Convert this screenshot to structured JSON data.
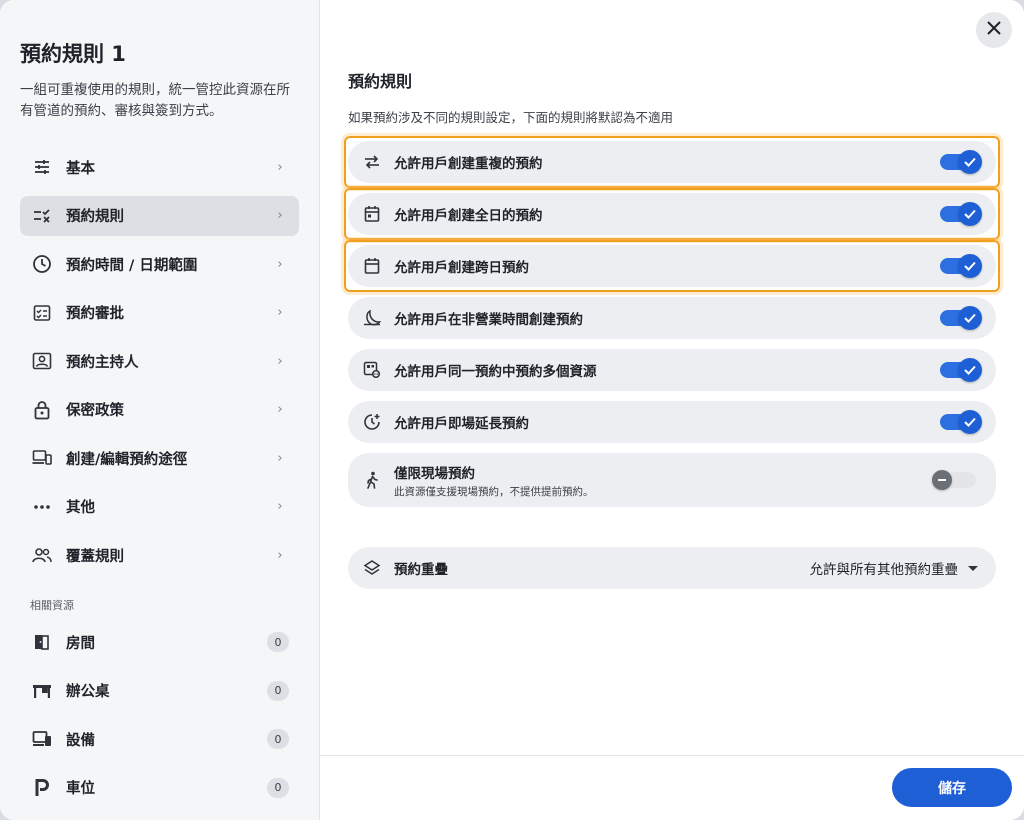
{
  "sidebar": {
    "title": "預約規則 1",
    "description": "一組可重複使用的規則，統一管控此資源在所有管道的預約、審核與簽到方式。",
    "items": [
      {
        "label": "基本",
        "icon": "sliders-icon"
      },
      {
        "label": "預約規則",
        "icon": "rule-list-icon",
        "active": true
      },
      {
        "label": "預約時間 / 日期範圍",
        "icon": "clock-icon"
      },
      {
        "label": "預約審批",
        "icon": "approval-checklist-icon"
      },
      {
        "label": "預約主持人",
        "icon": "host-badge-icon"
      },
      {
        "label": "保密政策",
        "icon": "lock-icon"
      },
      {
        "label": "創建/編輯預約途徑",
        "icon": "devices-icon"
      },
      {
        "label": "其他",
        "icon": "more-dots-icon"
      },
      {
        "label": "覆蓋規則",
        "icon": "people-icon"
      }
    ],
    "related_section_label": "相關資源",
    "resources": [
      {
        "label": "房間",
        "count": "0",
        "icon": "door-icon"
      },
      {
        "label": "辦公桌",
        "count": "0",
        "icon": "desk-icon"
      },
      {
        "label": "設備",
        "count": "0",
        "icon": "equipment-icon"
      },
      {
        "label": "車位",
        "count": "0",
        "icon": "parking-icon"
      }
    ]
  },
  "main": {
    "title": "預約規則",
    "subtitle": "如果預約涉及不同的規則設定，下面的規則將默認為不適用",
    "rows": [
      {
        "label": "允許用戶創建重複的預約",
        "enabled": true,
        "icon": "repeat-icon",
        "highlighted": true
      },
      {
        "label": "允許用戶創建全日的預約",
        "enabled": true,
        "icon": "calendar-day-icon",
        "highlighted": true
      },
      {
        "label": "允許用戶創建跨日預約",
        "enabled": true,
        "icon": "calendar-range-icon",
        "highlighted": true
      },
      {
        "label": "允許用戶在非營業時間創建預約",
        "enabled": true,
        "icon": "moon-icon"
      },
      {
        "label": "允許用戶同一預約中預約多個資源",
        "enabled": true,
        "icon": "multi-resource-icon"
      },
      {
        "label": "允許用戶即場延長預約",
        "enabled": true,
        "icon": "extend-time-icon"
      }
    ],
    "walkin": {
      "label": "僅限現場預約",
      "sublabel": "此資源僅支援現場預約，不提供提前預約。",
      "enabled": false,
      "icon": "walking-person-icon"
    },
    "overlap": {
      "label": "預約重疊",
      "value": "允許與所有其他預約重疊",
      "icon": "layers-icon"
    },
    "save_label": "儲存"
  },
  "colors": {
    "accent": "#1f5fd6",
    "highlight": "#f0a020"
  }
}
